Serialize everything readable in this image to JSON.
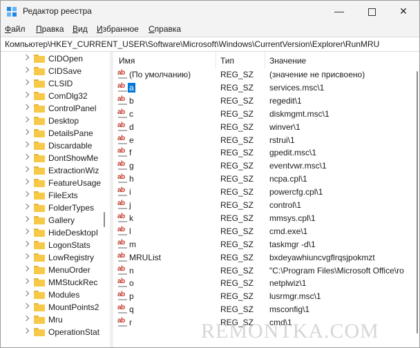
{
  "window": {
    "title": "Редактор реестра"
  },
  "controls": {
    "minimize": "—",
    "close": "✕"
  },
  "menu": [
    {
      "first": "Ф",
      "rest": "айл"
    },
    {
      "first": "П",
      "rest": "равка"
    },
    {
      "first": "В",
      "rest": "ид"
    },
    {
      "first": "И",
      "rest": "збранное"
    },
    {
      "first": "С",
      "rest": "правка"
    }
  ],
  "address": "Компьютер\\HKEY_CURRENT_USER\\Software\\Microsoft\\Windows\\CurrentVersion\\Explorer\\RunMRU",
  "tree": [
    "CIDOpen",
    "CIDSave",
    "CLSID",
    "ComDlg32",
    "ControlPanel",
    "Desktop",
    "DetailsPane",
    "Discardable",
    "DontShowMe",
    "ExtractionWiz",
    "FeatureUsage",
    "FileExts",
    "FolderTypes",
    "Gallery",
    "HideDesktopI",
    "LogonStats",
    "LowRegistry",
    "MenuOrder",
    "MMStuckRec",
    "Modules",
    "MountPoints2",
    "Mru",
    "OperationStat"
  ],
  "columns": {
    "name": "Имя",
    "type": "Тип",
    "value": "Значение"
  },
  "rows": [
    {
      "name": "(По умолчанию)",
      "type": "REG_SZ",
      "value": "(значение не присвоено)"
    },
    {
      "name": "a",
      "type": "REG_SZ",
      "value": "services.msc\\1",
      "selected": true
    },
    {
      "name": "b",
      "type": "REG_SZ",
      "value": "regedit\\1"
    },
    {
      "name": "c",
      "type": "REG_SZ",
      "value": "diskmgmt.msc\\1"
    },
    {
      "name": "d",
      "type": "REG_SZ",
      "value": "winver\\1"
    },
    {
      "name": "e",
      "type": "REG_SZ",
      "value": "rstrui\\1"
    },
    {
      "name": "f",
      "type": "REG_SZ",
      "value": "gpedit.msc\\1"
    },
    {
      "name": "g",
      "type": "REG_SZ",
      "value": "eventvwr.msc\\1"
    },
    {
      "name": "h",
      "type": "REG_SZ",
      "value": "ncpa.cpl\\1"
    },
    {
      "name": "i",
      "type": "REG_SZ",
      "value": "powercfg.cpl\\1"
    },
    {
      "name": "j",
      "type": "REG_SZ",
      "value": "control\\1"
    },
    {
      "name": "k",
      "type": "REG_SZ",
      "value": "mmsys.cpl\\1"
    },
    {
      "name": "l",
      "type": "REG_SZ",
      "value": "cmd.exe\\1"
    },
    {
      "name": "m",
      "type": "REG_SZ",
      "value": "taskmgr -d\\1"
    },
    {
      "name": "MRUList",
      "type": "REG_SZ",
      "value": "bxdeyawhiuncvgflrqsjpokmzt"
    },
    {
      "name": "n",
      "type": "REG_SZ",
      "value": "\"C:\\Program Files\\Microsoft Office\\ro"
    },
    {
      "name": "o",
      "type": "REG_SZ",
      "value": "netplwiz\\1"
    },
    {
      "name": "p",
      "type": "REG_SZ",
      "value": "lusrmgr.msc\\1"
    },
    {
      "name": "q",
      "type": "REG_SZ",
      "value": "msconfig\\1"
    },
    {
      "name": "r",
      "type": "REG_SZ",
      "value": "cmd\\1"
    }
  ],
  "watermark": "REMONTKA.COM"
}
